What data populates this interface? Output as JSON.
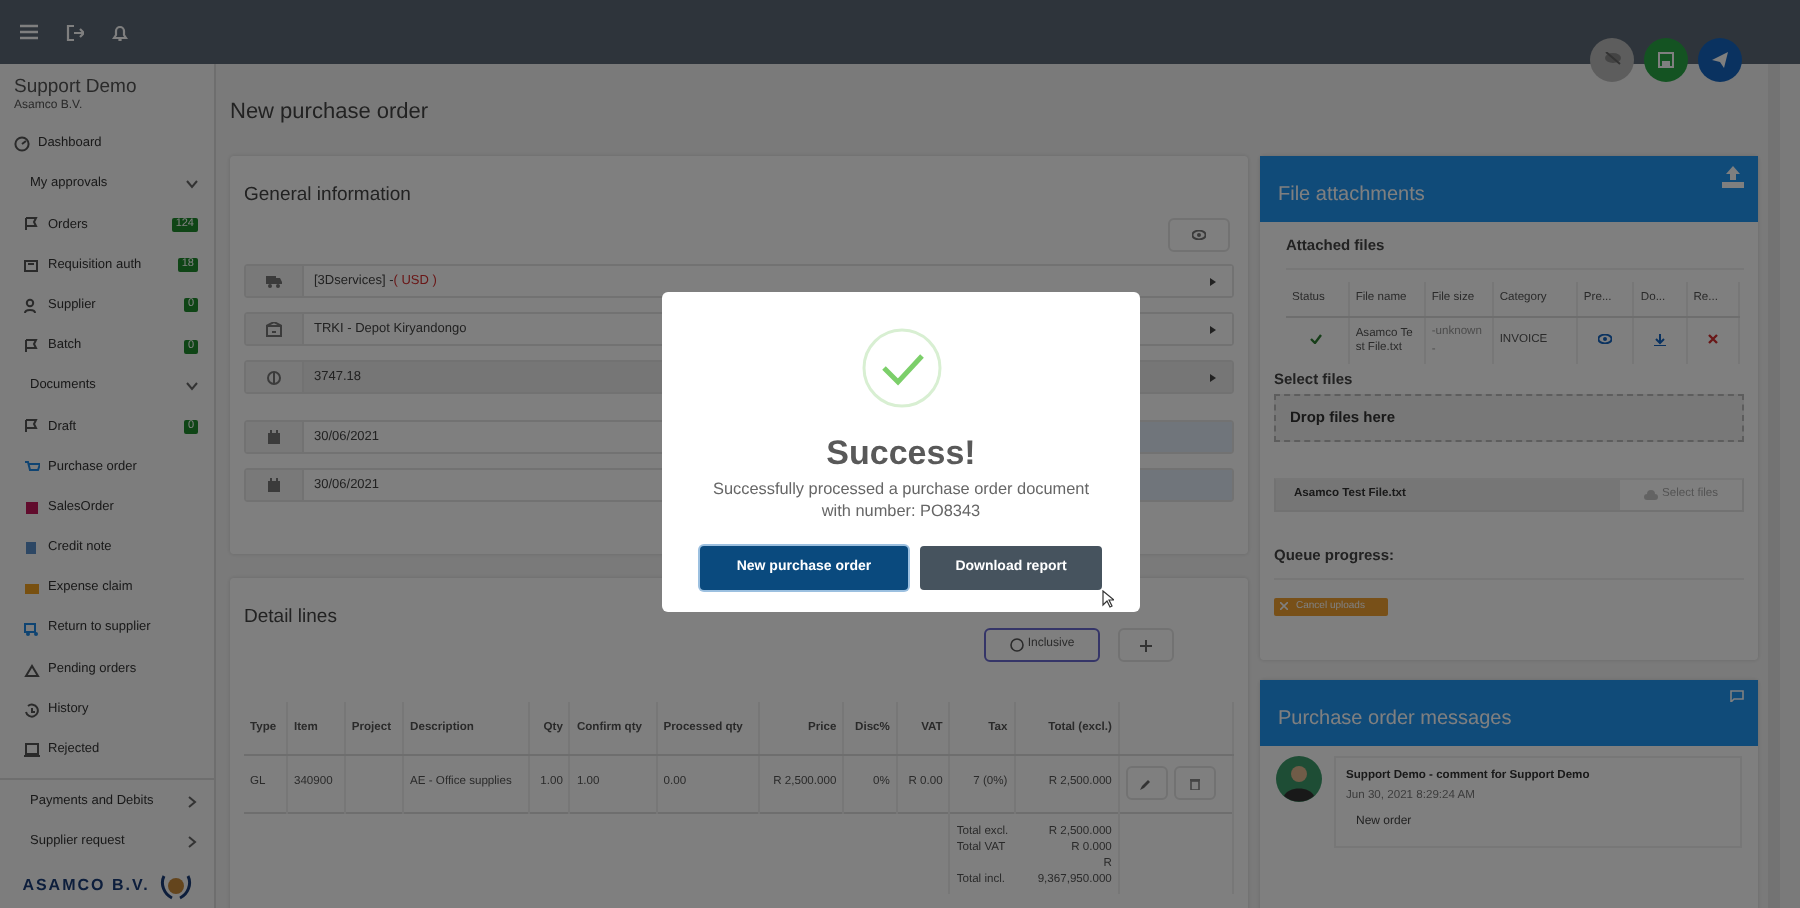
{
  "sidebar": {
    "user": "Support Demo",
    "company": "Asamco B.V.",
    "items": [
      {
        "kind": "link",
        "label": "Dashboard"
      },
      {
        "kind": "group",
        "label": "My approvals",
        "expanded": true,
        "children": [
          {
            "label": "Orders",
            "badge": "124"
          },
          {
            "label": "Requisition auth",
            "badge": "18"
          },
          {
            "label": "Supplier",
            "badge": "0"
          },
          {
            "label": "Batch",
            "badge": "0"
          }
        ]
      },
      {
        "kind": "group",
        "label": "Documents",
        "expanded": true,
        "children": [
          {
            "label": "Draft",
            "badge": "0"
          },
          {
            "label": "Purchase order"
          },
          {
            "label": "SalesOrder"
          },
          {
            "label": "Credit note"
          },
          {
            "label": "Expense claim"
          },
          {
            "label": "Return to supplier"
          },
          {
            "label": "Pending orders"
          },
          {
            "label": "History"
          },
          {
            "label": "Rejected"
          }
        ]
      },
      {
        "kind": "group",
        "label": "Payments and Debits",
        "expanded": false
      },
      {
        "kind": "group",
        "label": "Supplier request",
        "expanded": false
      }
    ],
    "logo_text": "ASAMCO B.V."
  },
  "page_title": "New purchase order",
  "general_information": {
    "title": "General information",
    "fields": [
      {
        "kind": "select",
        "value": "[3Dservices] -",
        "note": "( USD )"
      },
      {
        "kind": "select",
        "value": "TRKI - Depot Kiryandongo"
      },
      {
        "kind": "amount",
        "value": "3747.18"
      },
      {
        "kind": "date",
        "value": "30/06/2021"
      },
      {
        "kind": "date",
        "value": "30/06/2021"
      }
    ]
  },
  "detail_lines": {
    "title": "Detail lines",
    "inclusive": {
      "label": "Inclusive",
      "checked": false
    },
    "columns": [
      "Type",
      "Item",
      "Project",
      "Description",
      "Qty",
      "Confirm qty",
      "Processed qty",
      "Price",
      "Disc%",
      "VAT",
      "Tax",
      "Total (excl.)"
    ],
    "rows": [
      {
        "cells": [
          "GL",
          "340900",
          null,
          "AE - Office supplies",
          "1.00",
          "1.00",
          "0.00",
          "R 2,500.000",
          "0%",
          "R 0.00",
          "7 (0%)",
          "R 2,500.000"
        ]
      }
    ],
    "totals": [
      {
        "label": "Total excl.",
        "value": "R 2,500.000"
      },
      {
        "label": "Total VAT",
        "value": "R 0.000"
      },
      {
        "label": "Total incl.",
        "value": "R 9,367,950.000"
      }
    ]
  },
  "file_attachments": {
    "title": "File attachments",
    "attached_title": "Attached files",
    "columns": [
      "Status",
      "File name",
      "File size",
      "Category",
      "Pre...",
      "Do...",
      "Re..."
    ],
    "files": [
      {
        "uploaded": true,
        "file_name": "Asamco Test File.txt",
        "file_size": "-unknown-",
        "category": "INVOICE"
      }
    ],
    "select_title": "Select files",
    "dropzone": "Drop files here",
    "file_value": "Asamco Test File.txt",
    "select_button": {
      "label": "Select files",
      "disabled": true
    },
    "queue_title": "Queue progress:",
    "cancel_button": "Cancel uploads"
  },
  "messages": {
    "title": "Purchase order messages",
    "items": [
      {
        "heading": "Support Demo - comment for Support Demo",
        "time": "Jun 30, 2021 8:29:24 AM",
        "text": "New order"
      }
    ]
  },
  "modal": {
    "title": "Success!",
    "message": "Successfully processed a purchase order document with number: PO8343",
    "buttons": [
      {
        "label": "New purchase order",
        "kind": "primary"
      },
      {
        "label": "Download report",
        "kind": "secondary"
      }
    ]
  }
}
